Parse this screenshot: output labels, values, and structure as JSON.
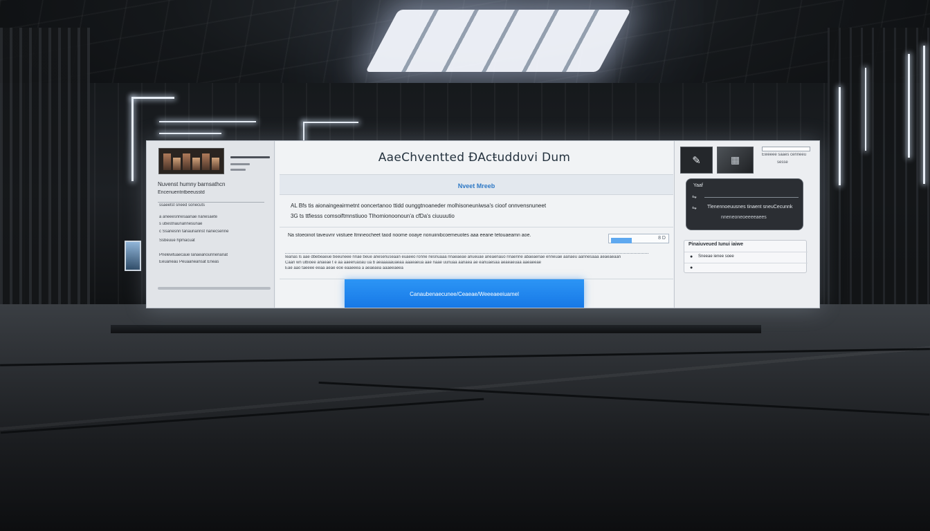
{
  "sidebar": {
    "title": "Nuvenst humny barnsathcn",
    "subtitle": "Encenuentntbeeusstd",
    "items": [
      "ssaeetst sneed sonecuts",
      "a  aneeesnnesaanae nanesaete",
      "s  ubestnaunannesunae",
      "c  Ssanesnn tanaunannst nanecsenne",
      "Ssbeuue hpmacuat",
      "Pnelewtuaecaue  lanaeanounnenanat",
      "Eeuaneau Peuaaneansat Eneas"
    ]
  },
  "main": {
    "title": "AaeChventted  ĐAcŧuddυvi Dum",
    "subtitle": "Nveet Mreeb",
    "body_lines": [
      "AL Bfs tis  aionaingeairmetnt ooncertanoo ttidd ounggtnoaneder  molhisoneuniwsa's  cioof  onnvensnuneet",
      "3G ts  ttfiesss  comsoiftmnstiuoo  Tlhomionoonoun'a cfDa's ciuuuutio"
    ],
    "field_label": "Na stoeoinot taveuvnr viistuee  ltmneocheet  taod  noome  ooaye  nonuiinibcoemeuotes aaa eeane  tetouaeamn aoe.",
    "field_value": "8 D",
    "paragraph_lines": [
      "Ieanas ls aae dbebeaeue beeuneee nnae beue anesenuseaan euaeeo ronne nesnuaaa nnaeaeae anueuae aneaenauo nnaenne abaeaenae enneuae aanaeu aannesaaa aeaeaeaan",
      "Caan wn ulbioee anaeae t e  aa  aaeeruaoau ua b aeaaaaauaeaa aaaeaeua   aae  naae uunuaa  aanaea   ae eanuaesaa aeaeaeuaa  aaeaeeae",
      "Eae  aao  taeeee  eeaa  aeae  eoe  eaaeeea a  aeaeaea  aaaeeaeea"
    ],
    "primary_button": "Canaubenaecunee/Ceaeae/Weeeaeeiuamel"
  },
  "right": {
    "top_label": "Eweeee saaes cenneeu",
    "top_meta": "sesse",
    "card": {
      "label": "Yaaf",
      "row1": "",
      "row2": "Tlenennoeuusnes tinaent sneuCecunnk",
      "foot": "nneneoneoeeeeaees"
    },
    "list": {
      "title": "Pinaiuveued Iunui iaiwe",
      "items": [
        "Sneeae ienee soee",
        ""
      ]
    }
  }
}
